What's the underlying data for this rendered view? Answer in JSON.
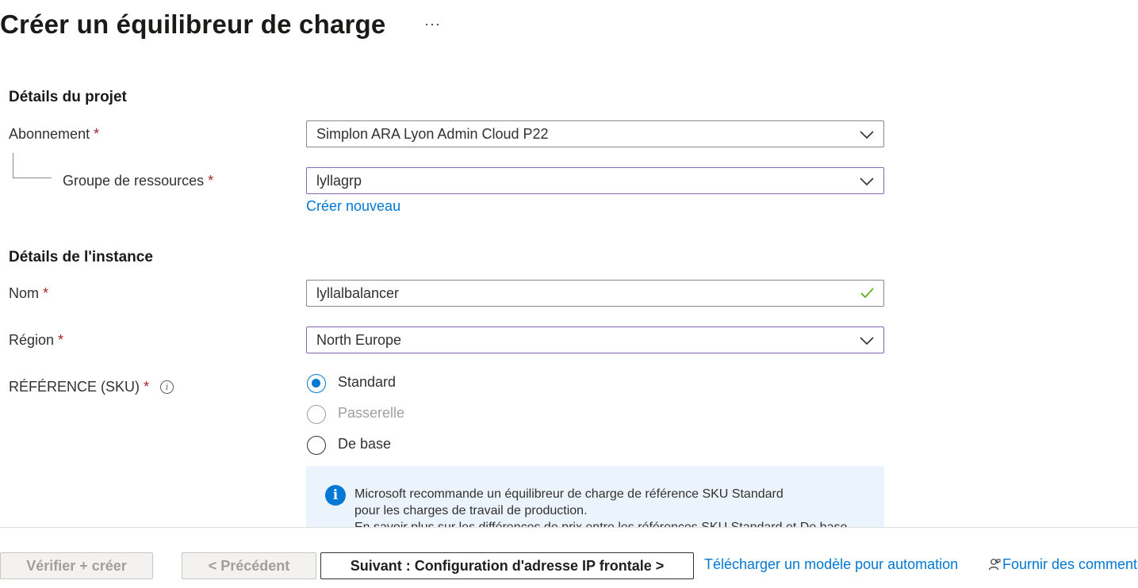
{
  "page": {
    "title": "Créer un équilibreur de charge",
    "more_label": "···"
  },
  "project_details": {
    "heading": "Détails du projet",
    "subscription": {
      "label": "Abonnement",
      "required": "*",
      "value": "Simplon ARA Lyon Admin Cloud P22",
      "icon": "chevron-down-icon"
    },
    "resource_group": {
      "label": "Groupe de ressources",
      "required": "*",
      "value": "lyllagrp",
      "icon": "chevron-down-icon",
      "create_new_link": "Créer nouveau"
    }
  },
  "instance_details": {
    "heading": "Détails de l'instance",
    "name": {
      "label": "Nom",
      "required": "*",
      "value": "lyllalbalancer",
      "icon": "checkmark-icon"
    },
    "region": {
      "label": "Région",
      "required": "*",
      "value": "North Europe",
      "icon": "chevron-down-icon"
    },
    "sku": {
      "label": "RÉFÉRENCE (SKU)",
      "required": "*",
      "info": "i",
      "options": [
        {
          "label": "Standard",
          "state": "checked"
        },
        {
          "label": "Passerelle",
          "state": "disabled"
        },
        {
          "label": "De base",
          "state": "unchecked"
        }
      ]
    },
    "info_box": {
      "icon": "info-icon",
      "line1": "Microsoft recommande un équilibreur de charge de référence SKU Standard",
      "line2": "pour les charges de travail de production.",
      "line3": "En savoir plus sur les différences de prix entre les références SKU Standard et De base"
    }
  },
  "footer": {
    "review_create": "Vérifier + créer",
    "previous": "< Précédent",
    "next": "Suivant : Configuration d'adresse IP frontale >",
    "download_template": "Télécharger un modèle pour automation",
    "feedback": "Fournir des commentaires"
  },
  "colors": {
    "accent": "#0078d4",
    "required": "#a4262c",
    "focus_border": "#8764b8",
    "valid_check": "#57a300",
    "info_background": "#ebf3fc"
  }
}
